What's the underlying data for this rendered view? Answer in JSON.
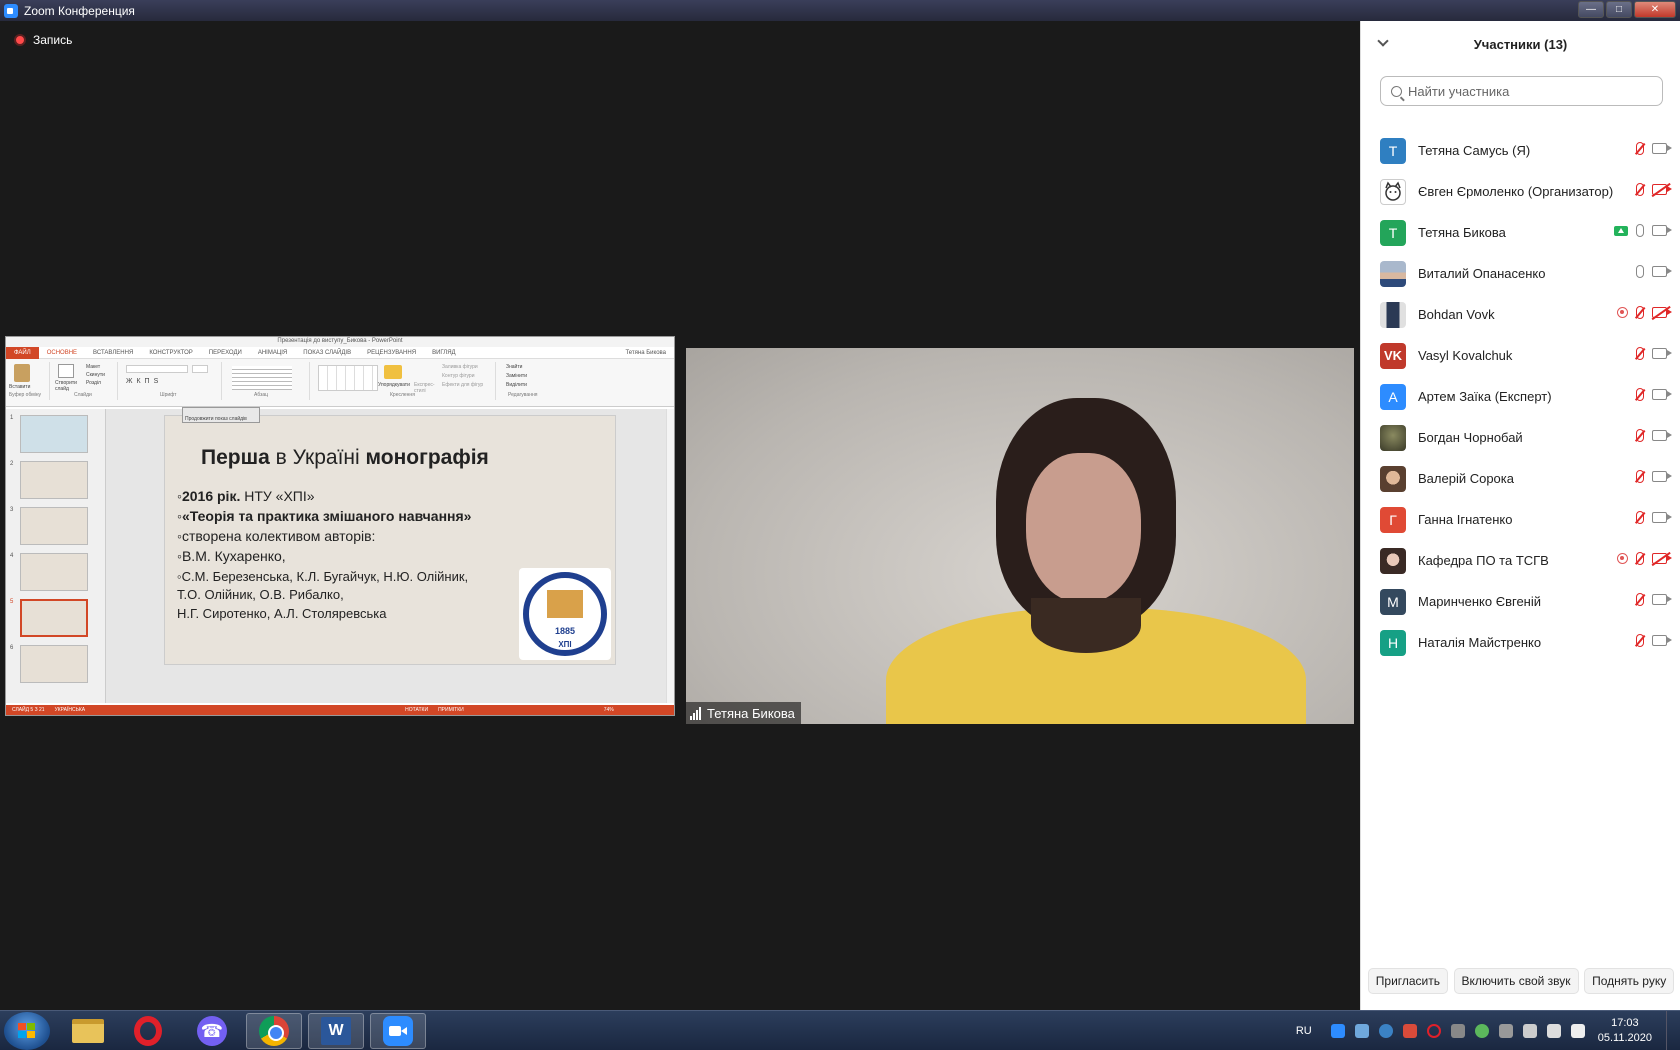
{
  "window": {
    "title": "Zoom Конференция"
  },
  "meeting": {
    "recording_label": "Запись"
  },
  "powerpoint": {
    "window_title": "Презентація до виступу_Бикова - PowerPoint",
    "user": "Тетяна Бикова",
    "tabs": [
      "ФАЙЛ",
      "ОСНОВНЕ",
      "ВСТАВЛЕННЯ",
      "КОНСТРУКТОР",
      "ПЕРЕХОДИ",
      "АНІМАЦІЯ",
      "ПОКАЗ СЛАЙДІВ",
      "РЕЦЕНЗУВАННЯ",
      "ВИГЛЯД"
    ],
    "ribbon_groups": [
      "Буфер обміну",
      "Слайди",
      "Шрифт",
      "Абзац",
      "Креслення",
      "Редагування"
    ],
    "ribbon_buttons": {
      "paste": "Вставити",
      "new_slide": "Створити слайд",
      "layout": "Макет",
      "reset": "Скинути",
      "section": "Розділ",
      "arrange": "Упорядкувати",
      "quick_styles": "Експрес-стилі",
      "shape_fill": "Заливка фігури",
      "shape_outline": "Контур фігури",
      "shape_effects": "Ефекти для фігур",
      "find": "Знайти",
      "replace": "Замінити",
      "select": "Виділити"
    },
    "tooltip": "Продовжити показ слайдів",
    "slide_numbers": [
      "1",
      "2",
      "3",
      "4",
      "5",
      "6"
    ],
    "status": {
      "slide": "СЛАЙД 5 З 21",
      "language": "УКРАЇНСЬКА",
      "notes": "НОТАТКИ",
      "comments": "ПРИМІТКИ",
      "zoom": "74%"
    },
    "slide": {
      "title_bold1": "Перша",
      "title_mid": " в Україні ",
      "title_bold2": "монографія",
      "line1_bold": "2016 рік.",
      "line1_rest": " НТУ «ХПІ»",
      "line2": "«Теорія та практика змішаного навчання»",
      "line3": "створена колективом авторів:",
      "line4": "В.М. Кухаренко,",
      "line5": "С.М. Березенська, К.Л. Бугайчук, Н.Ю. Олійник,",
      "line6": "Т.О. Олійник, О.В. Рибалко,",
      "line7": "Н.Г. Сиротенко, А.Л. Столяревська",
      "seal_year": "1885",
      "seal_letters": "ХПІ"
    }
  },
  "video": {
    "name": "Тетяна Бикова"
  },
  "participants_panel": {
    "title": "Участники (13)",
    "search_placeholder": "Найти участника",
    "participants": [
      {
        "name": "Тетяна Самусь (Я)",
        "initials": "Т",
        "color": "#2f7fc1"
      },
      {
        "name": "Євген Єрмоленко (Организатор)",
        "initials": "",
        "color": "#ffffff"
      },
      {
        "name": "Тетяна Бикова",
        "initials": "Т",
        "color": "#23a55a"
      },
      {
        "name": "Виталий Опанасенко",
        "initials": "",
        "color": "#7b8aa3"
      },
      {
        "name": "Bohdan Vovk",
        "initials": "",
        "color": "#5a6a82"
      },
      {
        "name": "Vasyl Kovalchuk",
        "initials": "VK",
        "color": "#c0392b"
      },
      {
        "name": "Артем Заїка (Експерт)",
        "initials": "А",
        "color": "#2d8cff"
      },
      {
        "name": "Богдан Чорнобай",
        "initials": "",
        "color": "#4d5a3a"
      },
      {
        "name": "Валерій Сорока",
        "initials": "",
        "color": "#9a7a5a"
      },
      {
        "name": "Ганна Ігнатенко",
        "initials": "Г",
        "color": "#e04a35"
      },
      {
        "name": "Кафедра ПО та ТСГВ",
        "initials": "",
        "color": "#a07868"
      },
      {
        "name": "Маринченко Євгеній",
        "initials": "М",
        "color": "#34495e"
      },
      {
        "name": "Наталія Майстренко",
        "initials": "Н",
        "color": "#16a085"
      }
    ],
    "buttons": {
      "invite": "Пригласить",
      "unmute": "Включить свой звук",
      "raise_hand": "Поднять руку"
    }
  },
  "taskbar": {
    "language": "RU",
    "time": "17:03",
    "date": "05.11.2020"
  }
}
